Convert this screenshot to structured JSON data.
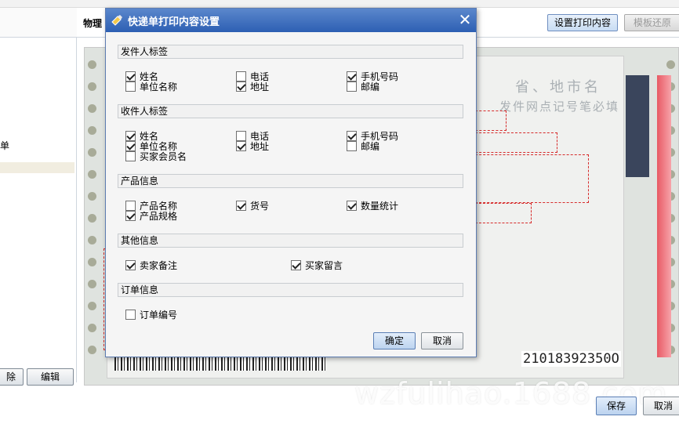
{
  "background": {
    "main_title": "物理",
    "set_print_button": "设置打印内容",
    "restore_button": "模板还原",
    "left_item_1": "单",
    "delete_button": "除",
    "edit_button": "编辑",
    "save_button": "保存",
    "cancel_button": "取消",
    "preview": {
      "faint_title": "省、地市名",
      "faint_sub": "发件网点记号笔必填",
      "tracking_number": "21018392350O",
      "watermark": "wzfulihao.1688.com"
    }
  },
  "dialog": {
    "title": "快递单打印内容设置",
    "close_glyph": "✕",
    "sections": [
      {
        "title": "发件人标签",
        "items": [
          {
            "label": "姓名",
            "checked": true
          },
          {
            "label": "单位名称",
            "checked": false
          },
          {
            "label": "电话",
            "checked": false
          },
          {
            "label": "地址",
            "checked": true
          },
          {
            "label": "手机号码",
            "checked": true
          },
          {
            "label": "邮编",
            "checked": false
          }
        ]
      },
      {
        "title": "收件人标签",
        "items": [
          {
            "label": "姓名",
            "checked": true
          },
          {
            "label": "单位名称",
            "checked": true
          },
          {
            "label": "买家会员名",
            "checked": false
          },
          {
            "label": "电话",
            "checked": false
          },
          {
            "label": "地址",
            "checked": true
          },
          {
            "label": "手机号码",
            "checked": true
          },
          {
            "label": "邮编",
            "checked": false
          }
        ]
      },
      {
        "title": "产品信息",
        "items": [
          {
            "label": "产品名称",
            "checked": false
          },
          {
            "label": "产品规格",
            "checked": true
          },
          {
            "label": "货号",
            "checked": true
          },
          {
            "label": "数量统计",
            "checked": true
          }
        ]
      },
      {
        "title": "其他信息",
        "items": [
          {
            "label": "卖家备注",
            "checked": true
          },
          {
            "label": "买家留言",
            "checked": true
          }
        ]
      },
      {
        "title": "订单信息",
        "items": [
          {
            "label": "订单编号",
            "checked": false
          }
        ]
      }
    ],
    "ok_button": "确定",
    "cancel_button": "取消"
  },
  "colors": {
    "titlebar": "#2d5fb3",
    "dashed_outline": "#d62b2b",
    "stripe_red": "#e85a64"
  }
}
